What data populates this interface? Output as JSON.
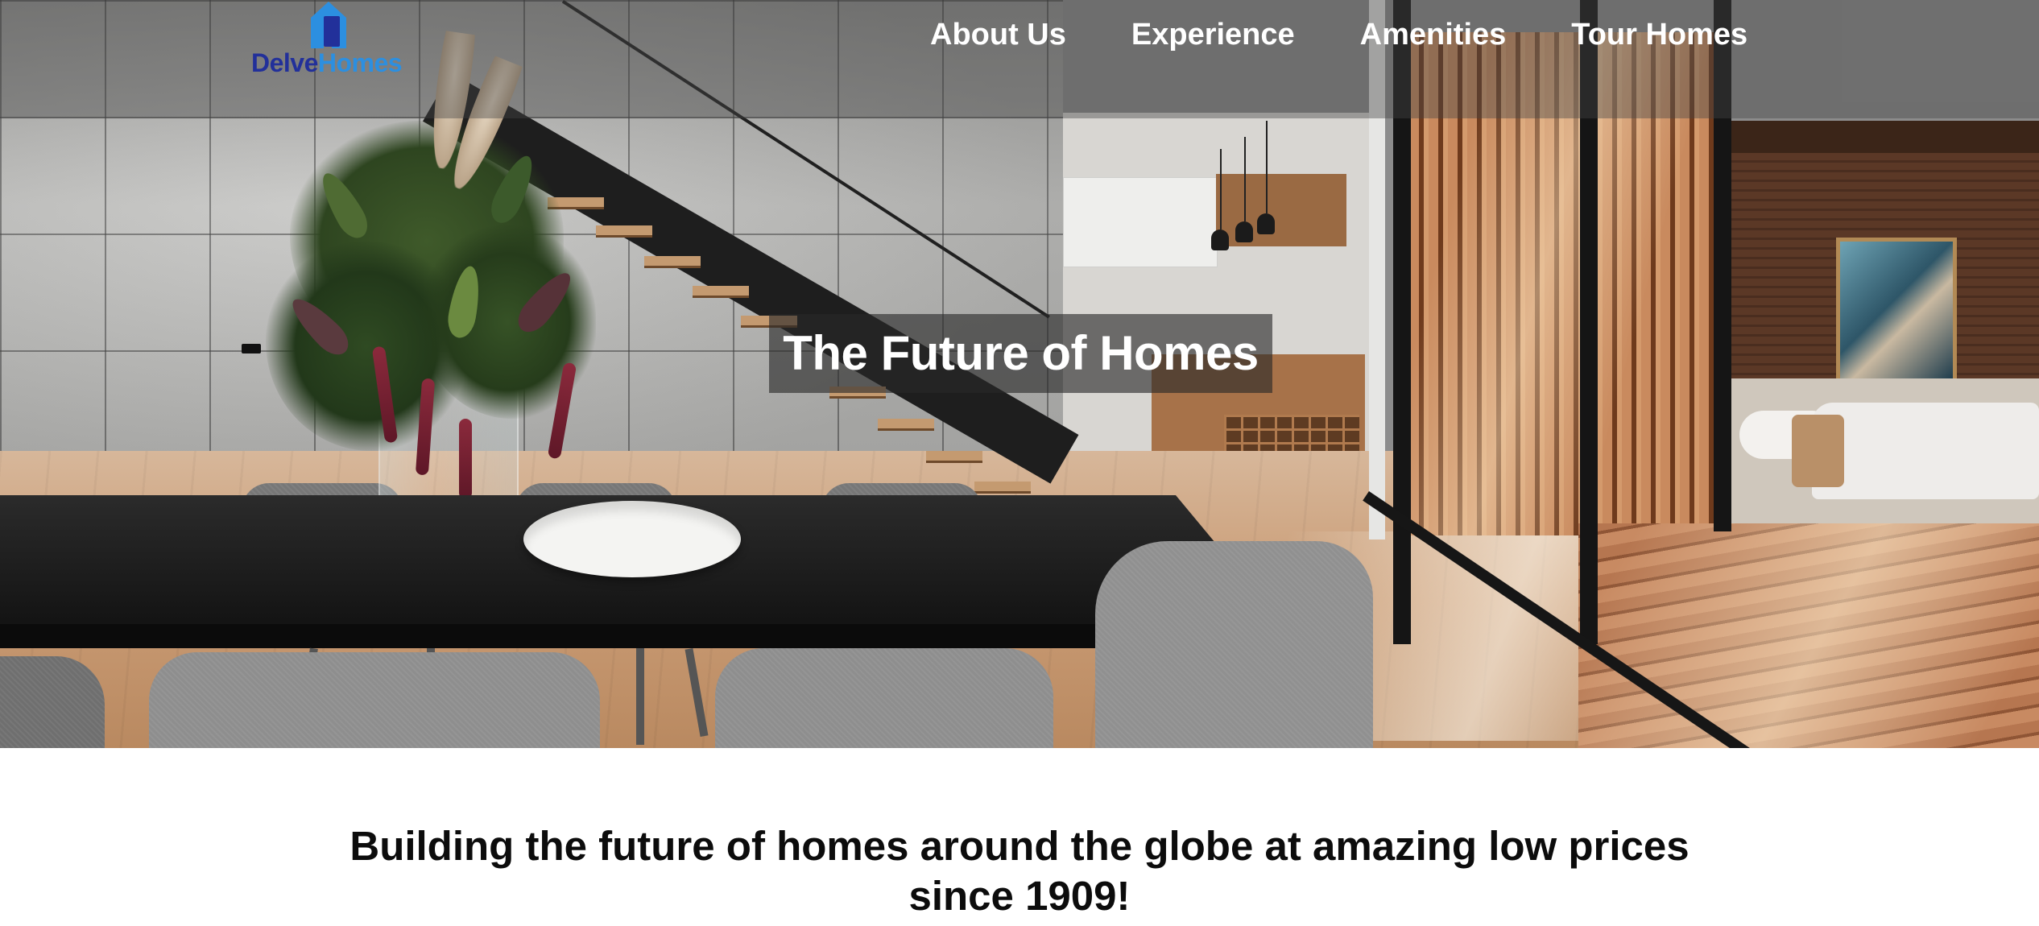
{
  "brand": {
    "name_part1": "Delve",
    "name_part2": "Homes",
    "icon": "house-logo-icon",
    "colors": {
      "primary": "#22309a",
      "accent": "#2c8fe0"
    }
  },
  "nav": {
    "items": [
      {
        "label": "About Us"
      },
      {
        "label": "Experience"
      },
      {
        "label": "Amenities"
      },
      {
        "label": "Tour Homes"
      }
    ]
  },
  "hero": {
    "title": "The Future of Homes",
    "image": "modern-interior-dining-kitchen-living-photo"
  },
  "main": {
    "tagline": "Building the future of homes around the globe at amazing low prices since 1909!"
  }
}
